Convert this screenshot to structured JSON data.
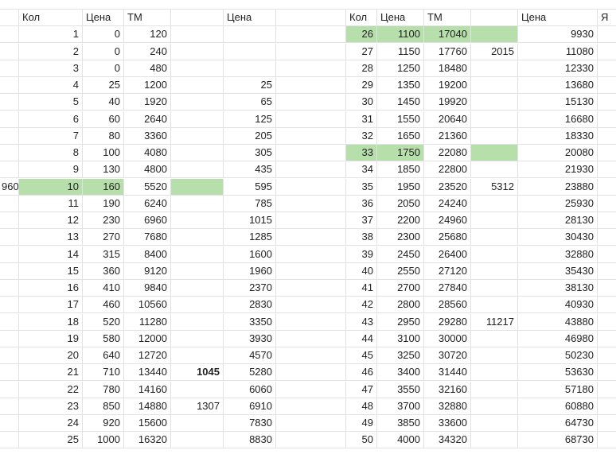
{
  "sheet": {
    "highlight_color": "#b7dfab",
    "left_headers": {
      "kol": "Кол",
      "price": "Цена",
      "tm": "ТМ",
      "price2": "Цена"
    },
    "right_headers": {
      "kol": "Кол",
      "price": "Цена",
      "tm": "ТМ",
      "price2": "Цена",
      "ya": "Я"
    },
    "top_stub": "",
    "left_rows": [
      {
        "a": "",
        "kol": "1",
        "price": "0",
        "tm": "120",
        "extra": "",
        "price2": ""
      },
      {
        "a": "",
        "kol": "2",
        "price": "0",
        "tm": "240",
        "extra": "",
        "price2": ""
      },
      {
        "a": "",
        "kol": "3",
        "price": "0",
        "tm": "480",
        "extra": "",
        "price2": ""
      },
      {
        "a": "",
        "kol": "4",
        "price": "25",
        "tm": "1200",
        "extra": "",
        "price2": "25"
      },
      {
        "a": "",
        "kol": "5",
        "price": "40",
        "tm": "1920",
        "extra": "",
        "price2": "65"
      },
      {
        "a": "",
        "kol": "6",
        "price": "60",
        "tm": "2640",
        "extra": "",
        "price2": "125"
      },
      {
        "a": "",
        "kol": "7",
        "price": "80",
        "tm": "3360",
        "extra": "",
        "price2": "205"
      },
      {
        "a": "",
        "kol": "8",
        "price": "100",
        "tm": "4080",
        "extra": "",
        "price2": "305"
      },
      {
        "a": "",
        "kol": "9",
        "price": "130",
        "tm": "4800",
        "extra": "",
        "price2": "435"
      },
      {
        "a": "960",
        "kol": "10",
        "price": "160",
        "tm": "5520",
        "extra": "",
        "price2": "595"
      },
      {
        "a": "",
        "kol": "11",
        "price": "190",
        "tm": "6240",
        "extra": "",
        "price2": "785"
      },
      {
        "a": "",
        "kol": "12",
        "price": "230",
        "tm": "6960",
        "extra": "",
        "price2": "1015"
      },
      {
        "a": "",
        "kol": "13",
        "price": "270",
        "tm": "7680",
        "extra": "",
        "price2": "1285"
      },
      {
        "a": "",
        "kol": "14",
        "price": "315",
        "tm": "8400",
        "extra": "",
        "price2": "1600"
      },
      {
        "a": "",
        "kol": "15",
        "price": "360",
        "tm": "9120",
        "extra": "",
        "price2": "1960"
      },
      {
        "a": "",
        "kol": "16",
        "price": "410",
        "tm": "9840",
        "extra": "",
        "price2": "2370"
      },
      {
        "a": "",
        "kol": "17",
        "price": "460",
        "tm": "10560",
        "extra": "",
        "price2": "2830"
      },
      {
        "a": "",
        "kol": "18",
        "price": "520",
        "tm": "11280",
        "extra": "",
        "price2": "3350"
      },
      {
        "a": "",
        "kol": "19",
        "price": "580",
        "tm": "12000",
        "extra": "",
        "price2": "3930"
      },
      {
        "a": "",
        "kol": "20",
        "price": "640",
        "tm": "12720",
        "extra": "",
        "price2": "4570"
      },
      {
        "a": "",
        "kol": "21",
        "price": "710",
        "tm": "13440",
        "extra": "1045",
        "price2": "5280"
      },
      {
        "a": "",
        "kol": "22",
        "price": "780",
        "tm": "14160",
        "extra": "",
        "price2": "6060"
      },
      {
        "a": "",
        "kol": "23",
        "price": "850",
        "tm": "14880",
        "extra": "1307",
        "price2": "6910"
      },
      {
        "a": "",
        "kol": "24",
        "price": "920",
        "tm": "15600",
        "extra": "",
        "price2": "7830"
      },
      {
        "a": "",
        "kol": "25",
        "price": "1000",
        "tm": "16320",
        "extra": "",
        "price2": "8830"
      }
    ],
    "right_rows": [
      {
        "kol": "26",
        "price": "1100",
        "tm": "17040",
        "extra": "",
        "price2": "9930"
      },
      {
        "kol": "27",
        "price": "1150",
        "tm": "17760",
        "extra": "2015",
        "price2": "11080"
      },
      {
        "kol": "28",
        "price": "1250",
        "tm": "18480",
        "extra": "",
        "price2": "12330"
      },
      {
        "kol": "29",
        "price": "1350",
        "tm": "19200",
        "extra": "",
        "price2": "13680"
      },
      {
        "kol": "30",
        "price": "1450",
        "tm": "19920",
        "extra": "",
        "price2": "15130"
      },
      {
        "kol": "31",
        "price": "1550",
        "tm": "20640",
        "extra": "",
        "price2": "16680"
      },
      {
        "kol": "32",
        "price": "1650",
        "tm": "21360",
        "extra": "",
        "price2": "18330"
      },
      {
        "kol": "33",
        "price": "1750",
        "tm": "22080",
        "extra": "",
        "price2": "20080"
      },
      {
        "kol": "34",
        "price": "1850",
        "tm": "22800",
        "extra": "",
        "price2": "21930"
      },
      {
        "kol": "35",
        "price": "1950",
        "tm": "23520",
        "extra": "5312",
        "price2": "23880"
      },
      {
        "kol": "36",
        "price": "2050",
        "tm": "24240",
        "extra": "",
        "price2": "25930"
      },
      {
        "kol": "37",
        "price": "2200",
        "tm": "24960",
        "extra": "",
        "price2": "28130"
      },
      {
        "kol": "38",
        "price": "2300",
        "tm": "25680",
        "extra": "",
        "price2": "30430"
      },
      {
        "kol": "39",
        "price": "2450",
        "tm": "26400",
        "extra": "",
        "price2": "32880"
      },
      {
        "kol": "40",
        "price": "2550",
        "tm": "27120",
        "extra": "",
        "price2": "35430"
      },
      {
        "kol": "41",
        "price": "2700",
        "tm": "27840",
        "extra": "",
        "price2": "38130"
      },
      {
        "kol": "42",
        "price": "2800",
        "tm": "28560",
        "extra": "",
        "price2": "40930"
      },
      {
        "kol": "43",
        "price": "2950",
        "tm": "29280",
        "extra": "11217",
        "price2": "43880"
      },
      {
        "kol": "44",
        "price": "3100",
        "tm": "30000",
        "extra": "",
        "price2": "46980"
      },
      {
        "kol": "45",
        "price": "3250",
        "tm": "30720",
        "extra": "",
        "price2": "50230"
      },
      {
        "kol": "46",
        "price": "3400",
        "tm": "31440",
        "extra": "",
        "price2": "53630"
      },
      {
        "kol": "47",
        "price": "3550",
        "tm": "32160",
        "extra": "",
        "price2": "57180"
      },
      {
        "kol": "48",
        "price": "3700",
        "tm": "32880",
        "extra": "",
        "price2": "60880"
      },
      {
        "kol": "49",
        "price": "3850",
        "tm": "33600",
        "extra": "",
        "price2": "64730"
      },
      {
        "kol": "50",
        "price": "4000",
        "tm": "34320",
        "extra": "",
        "price2": "68730"
      }
    ]
  }
}
